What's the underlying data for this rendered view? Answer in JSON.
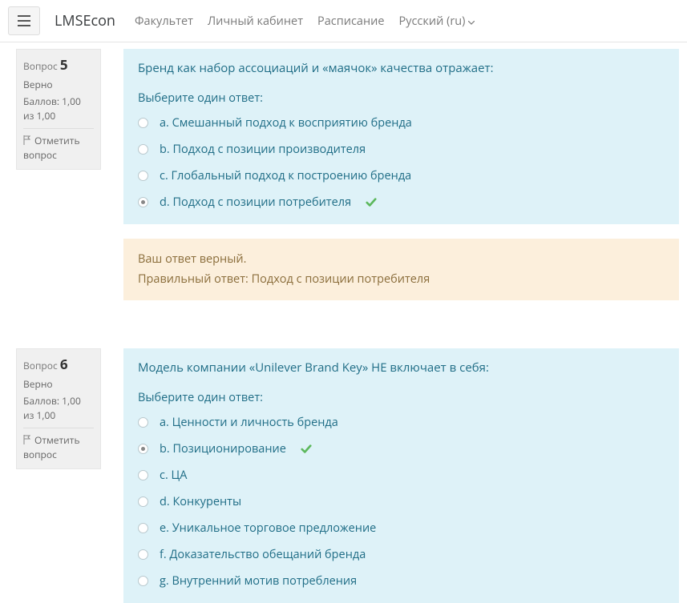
{
  "navbar": {
    "brand": "LMSEcon",
    "links": [
      "Факультет",
      "Личный кабинет",
      "Расписание"
    ],
    "lang": "Русский (ru)"
  },
  "questions": [
    {
      "label": "Вопрос",
      "number": "5",
      "status": "Верно",
      "score": "Баллов: 1,00 из 1,00",
      "flag": "Отметить вопрос",
      "text": "Бренд как набор ассоциаций и «маячок» качества отражает:",
      "prompt": "Выберите один ответ:",
      "answers": [
        {
          "l": "a.",
          "t": "Смешанный подход к восприятию бренда",
          "sel": false,
          "correct": false
        },
        {
          "l": "b.",
          "t": "Подход с позиции производителя",
          "sel": false,
          "correct": false
        },
        {
          "l": "c.",
          "t": "Глобальный подход к построению бренда",
          "sel": false,
          "correct": false
        },
        {
          "l": "d.",
          "t": "Подход с позиции потребителя",
          "sel": true,
          "correct": true
        }
      ],
      "feedback": {
        "line1": "Ваш ответ верный.",
        "line2": "Правильный ответ: Подход с позиции потребителя"
      }
    },
    {
      "label": "Вопрос",
      "number": "6",
      "status": "Верно",
      "score": "Баллов: 1,00 из 1,00",
      "flag": "Отметить вопрос",
      "text": "Модель компании «Unilever Brand Key» НЕ включает в себя:",
      "prompt": "Выберите один ответ:",
      "answers": [
        {
          "l": "a.",
          "t": "Ценности и личность бренда",
          "sel": false,
          "correct": false
        },
        {
          "l": "b.",
          "t": "Позиционирование",
          "sel": true,
          "correct": true
        },
        {
          "l": "c.",
          "t": "ЦА",
          "sel": false,
          "correct": false
        },
        {
          "l": "d.",
          "t": "Конкуренты",
          "sel": false,
          "correct": false
        },
        {
          "l": "e.",
          "t": "Уникальное торговое предложение",
          "sel": false,
          "correct": false
        },
        {
          "l": "f.",
          "t": "Доказательство обещаний бренда",
          "sel": false,
          "correct": false
        },
        {
          "l": "g.",
          "t": "Внутренний мотив потребления",
          "sel": false,
          "correct": false
        }
      ],
      "feedback": null
    }
  ]
}
